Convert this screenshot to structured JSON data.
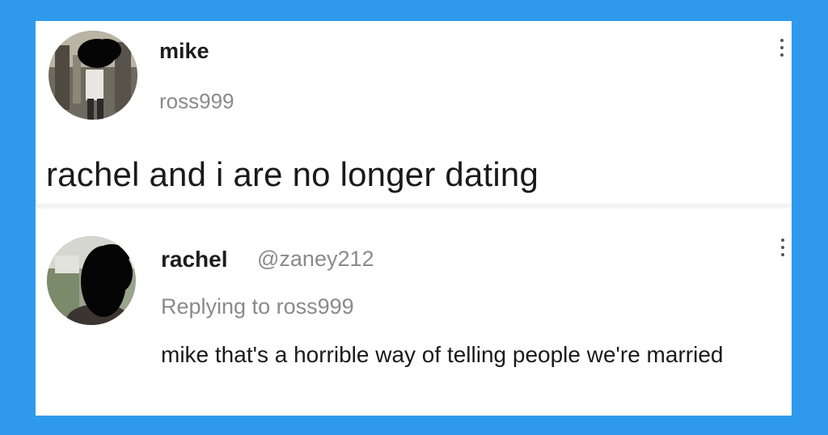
{
  "post": {
    "display_name": "mike",
    "username": "ross999",
    "text": "rachel and i are no longer dating",
    "avatar_icon": "user-photo-icon",
    "menu_icon": "more-vertical-icon"
  },
  "reply": {
    "display_name": "rachel",
    "username": "@zaney212",
    "replying_to": "Replying to ross999",
    "text": "mike that's a horrible way of telling people we're married",
    "avatar_icon": "user-photo-icon",
    "menu_icon": "more-vertical-icon"
  },
  "colors": {
    "frame": "#2f9aec",
    "card": "#ffffff",
    "name": "#1c1c1c",
    "muted": "#8a8a8a",
    "text": "#1a1a1a"
  }
}
